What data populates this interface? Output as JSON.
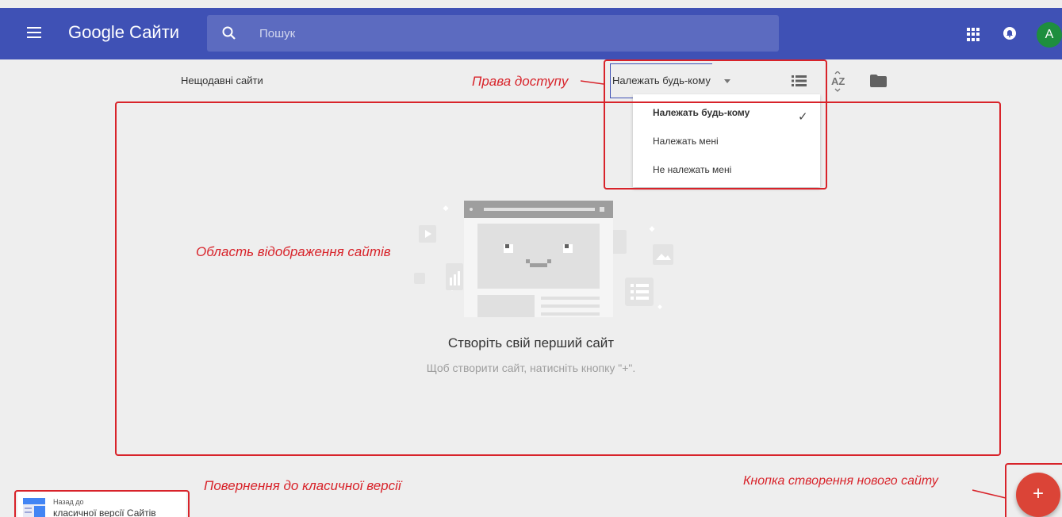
{
  "header": {
    "app_title": "Google Сайти",
    "search_placeholder": "Пошук",
    "avatar_letter": "A"
  },
  "toolbar": {
    "recent_label": "Нещодавні сайти",
    "owner_filter": "Належать будь-кому"
  },
  "owner_menu": {
    "items": [
      {
        "label": "Належать будь-кому",
        "checked": true
      },
      {
        "label": "Належать мені",
        "checked": false
      },
      {
        "label": "Не належать мені",
        "checked": false
      }
    ]
  },
  "empty_state": {
    "title": "Створіть свій перший сайт",
    "subtitle": "Щоб створити сайт, натисніть кнопку \"+\"."
  },
  "classic": {
    "small": "Назад до",
    "main": "класичної версії Сайтів"
  },
  "fab": {
    "label": "+"
  },
  "annotations": {
    "access": "Права доступу",
    "display_area": "Область відображення сайтів",
    "classic_return": "Повернення до класичної версії",
    "new_site": "Кнопка створення нового сайту"
  },
  "colors": {
    "topbar": "#3f51b5",
    "search_bg": "#5c6bc0",
    "annotation": "#d8232a",
    "fab": "#db4437",
    "avatar": "#1e8e3e"
  }
}
